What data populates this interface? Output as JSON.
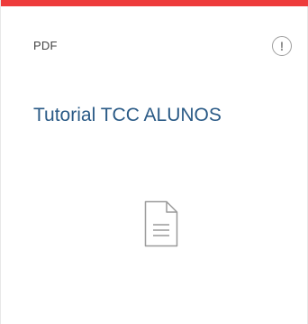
{
  "card": {
    "accent_color": "#ee3b3b",
    "file_type": "PDF",
    "title": "Tutorial TCC ALUNOS",
    "info_icon": "exclamation-circle-icon",
    "preview_icon": "document-icon"
  }
}
